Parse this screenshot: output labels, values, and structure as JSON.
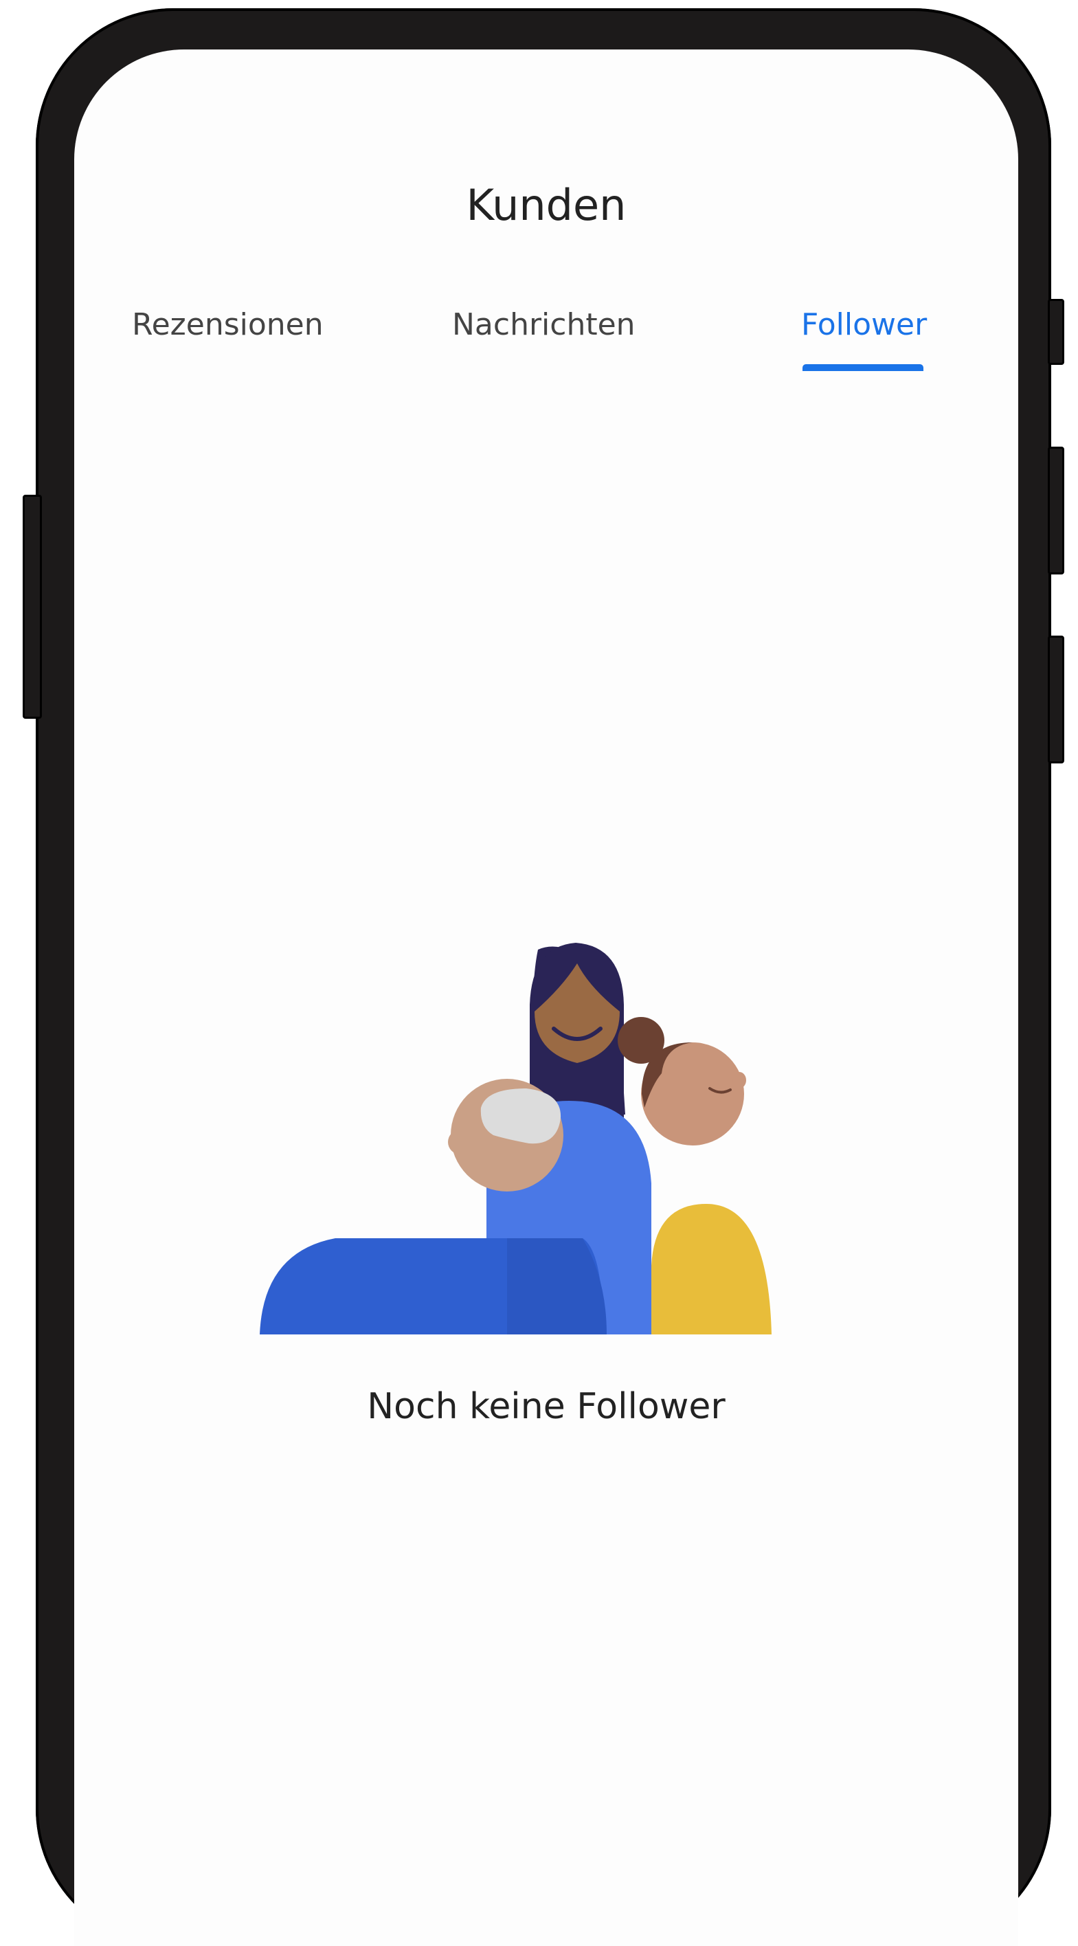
{
  "header": {
    "title": "Kunden"
  },
  "tabs": [
    {
      "label": "Rezensionen",
      "active": false
    },
    {
      "label": "Nachrichten",
      "active": false
    },
    {
      "label": "Follower",
      "active": true
    }
  ],
  "empty_state": {
    "message": "Noch keine Follower",
    "illustration": "people-group-illustration"
  },
  "colors": {
    "accent": "#1a73e8",
    "frame": "#1c1a1a",
    "text": "#222222"
  }
}
